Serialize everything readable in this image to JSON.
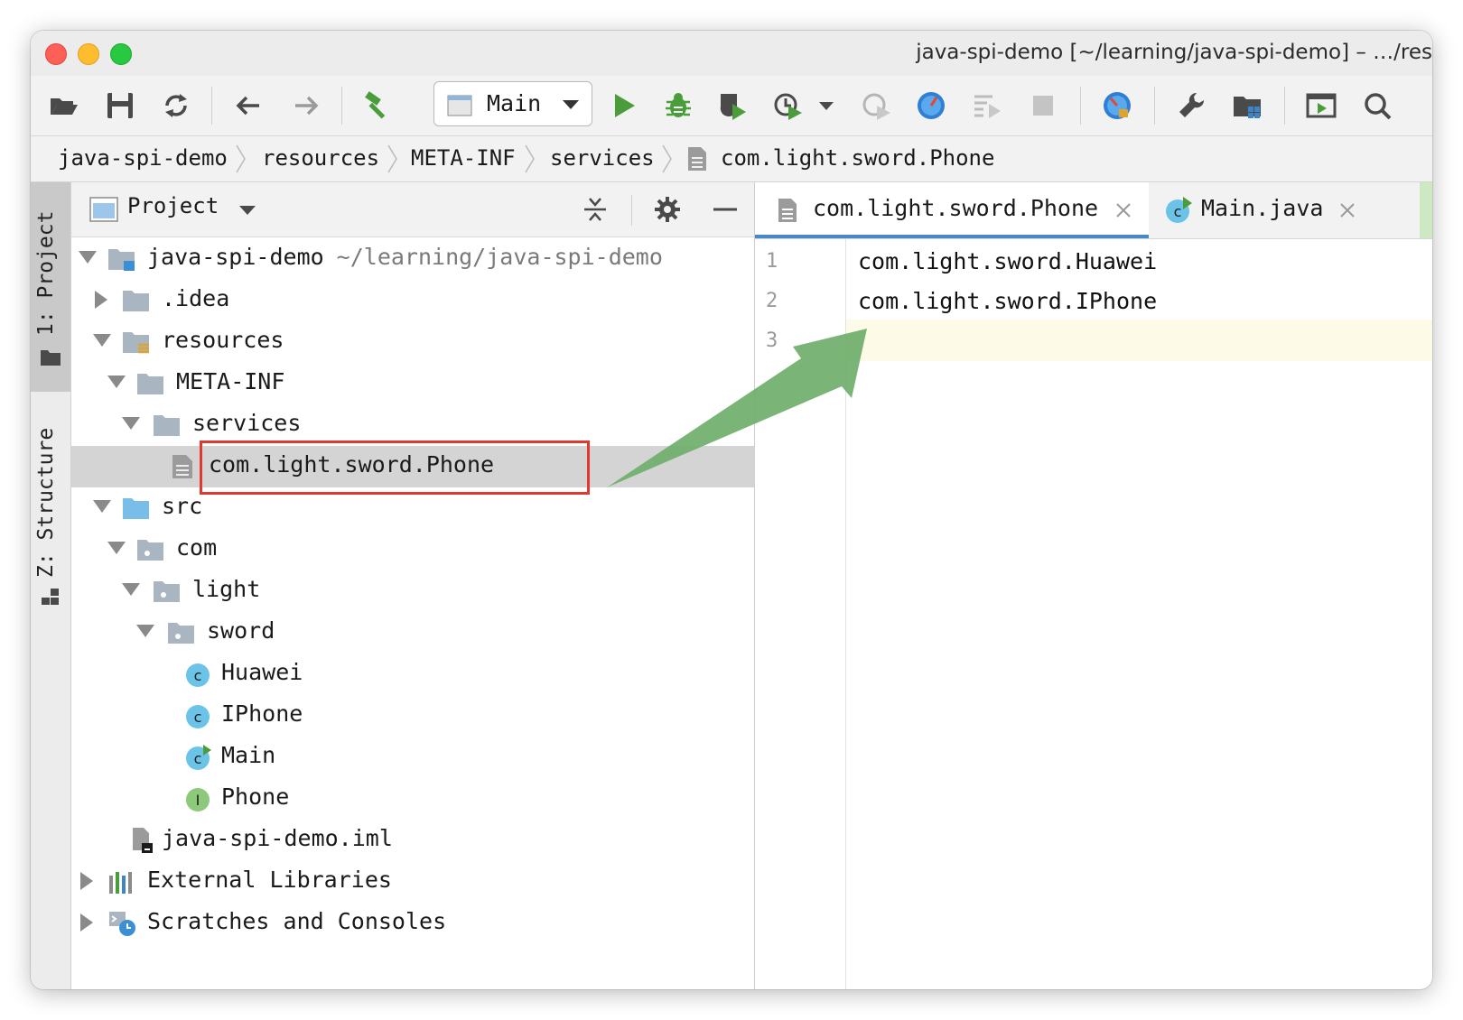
{
  "window": {
    "title": "java-spi-demo [~/learning/java-spi-demo] – …/res"
  },
  "toolbar": {
    "run_config": "Main"
  },
  "breadcrumb": [
    "java-spi-demo",
    "resources",
    "META-INF",
    "services",
    "com.light.sword.Phone"
  ],
  "tool_strip": {
    "project_tab": "1: Project",
    "structure_tab": "Z: Structure"
  },
  "project_panel": {
    "title": "Project",
    "tree": [
      {
        "label": "java-spi-demo",
        "path": "~/learning/java-spi-demo",
        "icon": "module-folder-icon",
        "expanded": true
      },
      {
        "label": ".idea",
        "icon": "folder-icon",
        "expanded": false
      },
      {
        "label": "resources",
        "icon": "resources-folder-icon",
        "expanded": true
      },
      {
        "label": "META-INF",
        "icon": "folder-icon",
        "expanded": true
      },
      {
        "label": "services",
        "icon": "folder-icon",
        "expanded": true
      },
      {
        "label": "com.light.sword.Phone",
        "icon": "text-file-icon",
        "selected": true
      },
      {
        "label": "src",
        "icon": "source-folder-icon",
        "expanded": true
      },
      {
        "label": "com",
        "icon": "package-icon",
        "expanded": true
      },
      {
        "label": "light",
        "icon": "package-icon",
        "expanded": true
      },
      {
        "label": "sword",
        "icon": "package-icon",
        "expanded": true
      },
      {
        "label": "Huawei",
        "icon": "class-icon"
      },
      {
        "label": "IPhone",
        "icon": "class-icon"
      },
      {
        "label": "Main",
        "icon": "runnable-class-icon"
      },
      {
        "label": "Phone",
        "icon": "interface-icon"
      },
      {
        "label": "java-spi-demo.iml",
        "icon": "iml-file-icon"
      },
      {
        "label": "External Libraries",
        "icon": "libraries-icon",
        "expanded": false
      },
      {
        "label": "Scratches and Consoles",
        "icon": "scratches-icon",
        "expanded": false
      }
    ]
  },
  "editor": {
    "tabs": [
      {
        "label": "com.light.sword.Phone",
        "active": true
      },
      {
        "label": "Main.java",
        "active": false
      }
    ],
    "line_numbers": [
      "1",
      "2",
      "3"
    ],
    "lines": [
      "com.light.sword.Huawei",
      "com.light.sword.IPhone",
      ""
    ]
  },
  "colors": {
    "highlight_box": "#e03a2f",
    "annotation_arrow": "#6fae6a",
    "class_icon": "#6bc4e8",
    "interface_icon": "#8cc97a"
  }
}
